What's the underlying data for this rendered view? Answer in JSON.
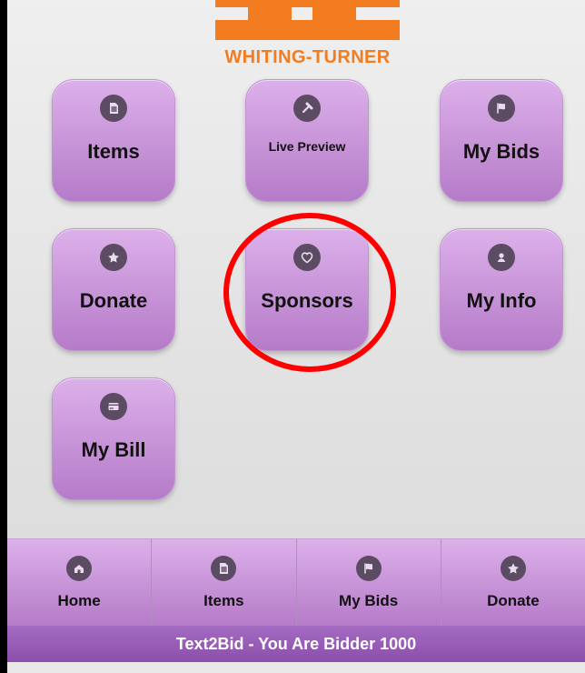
{
  "logo": {
    "text": "WHITING-TURNER"
  },
  "tiles": [
    {
      "label": "Items",
      "icon": "document-icon"
    },
    {
      "label": "Live Preview",
      "icon": "gavel-icon"
    },
    {
      "label": "My Bids",
      "icon": "flag-icon"
    },
    {
      "label": "Donate",
      "icon": "star-icon"
    },
    {
      "label": "Sponsors",
      "icon": "heart-icon"
    },
    {
      "label": "My Info",
      "icon": "person-icon"
    },
    {
      "label": "My Bill",
      "icon": "card-icon"
    }
  ],
  "tabbar": {
    "tabs": [
      {
        "label": "Home",
        "icon": "home-icon"
      },
      {
        "label": "Items",
        "icon": "document-icon"
      },
      {
        "label": "My Bids",
        "icon": "flag-icon"
      },
      {
        "label": "Donate",
        "icon": "star-icon"
      }
    ]
  },
  "footer": {
    "text": "Text2Bid - You Are Bidder 1000"
  },
  "colors": {
    "brand_orange": "#f47c20",
    "tile_purple_top": "#dcb0ea",
    "tile_purple_bottom": "#b57bc8",
    "footer_purple": "#9a5bbd",
    "highlight_red": "#ff0000"
  }
}
